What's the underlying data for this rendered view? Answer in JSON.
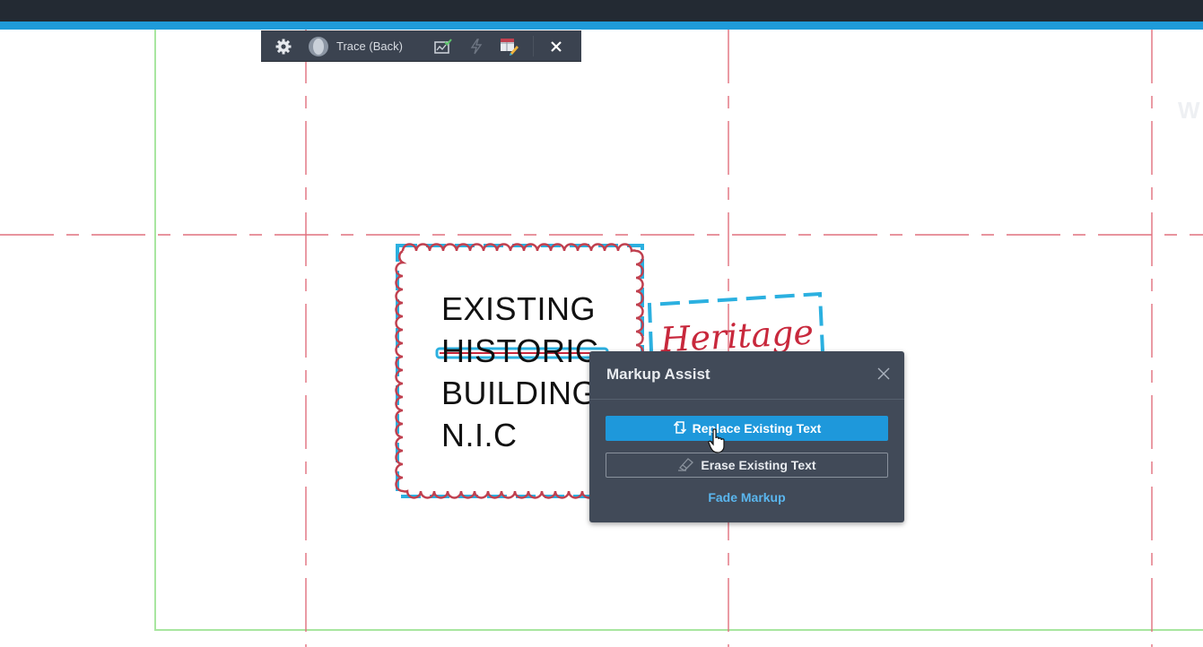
{
  "app": {
    "accent_color": "#1f9bd9",
    "topbar_color": "#232a33"
  },
  "toolbar": {
    "settings_icon": "gear-icon",
    "avatar_icon": "user-avatar-icon",
    "trace_label": "Trace (Back)",
    "icons": [
      "chart-check-icon",
      "lightning-icon",
      "markup-pencil-icon"
    ],
    "close_icon": "close-icon"
  },
  "drawing": {
    "note_lines": [
      "EXISTING",
      "HISTORIC",
      "BUILDING",
      "N.I.C"
    ],
    "struck_line": "HISTORIC",
    "handwritten_text": "Heritage",
    "colors": {
      "grid_line": "#e0707e",
      "boundary": "#a8e6a0",
      "revision_cloud": "#c0404f",
      "selection": "#2bb0e0",
      "handwriting": "#c8283c"
    },
    "watermark": "W"
  },
  "dialog": {
    "title": "Markup Assist",
    "close_icon": "close-icon",
    "primary_button": {
      "label": "Replace Existing Text",
      "icon": "replace-icon"
    },
    "secondary_button": {
      "label": "Erase Existing Text",
      "icon": "eraser-icon"
    },
    "link": "Fade Markup"
  }
}
